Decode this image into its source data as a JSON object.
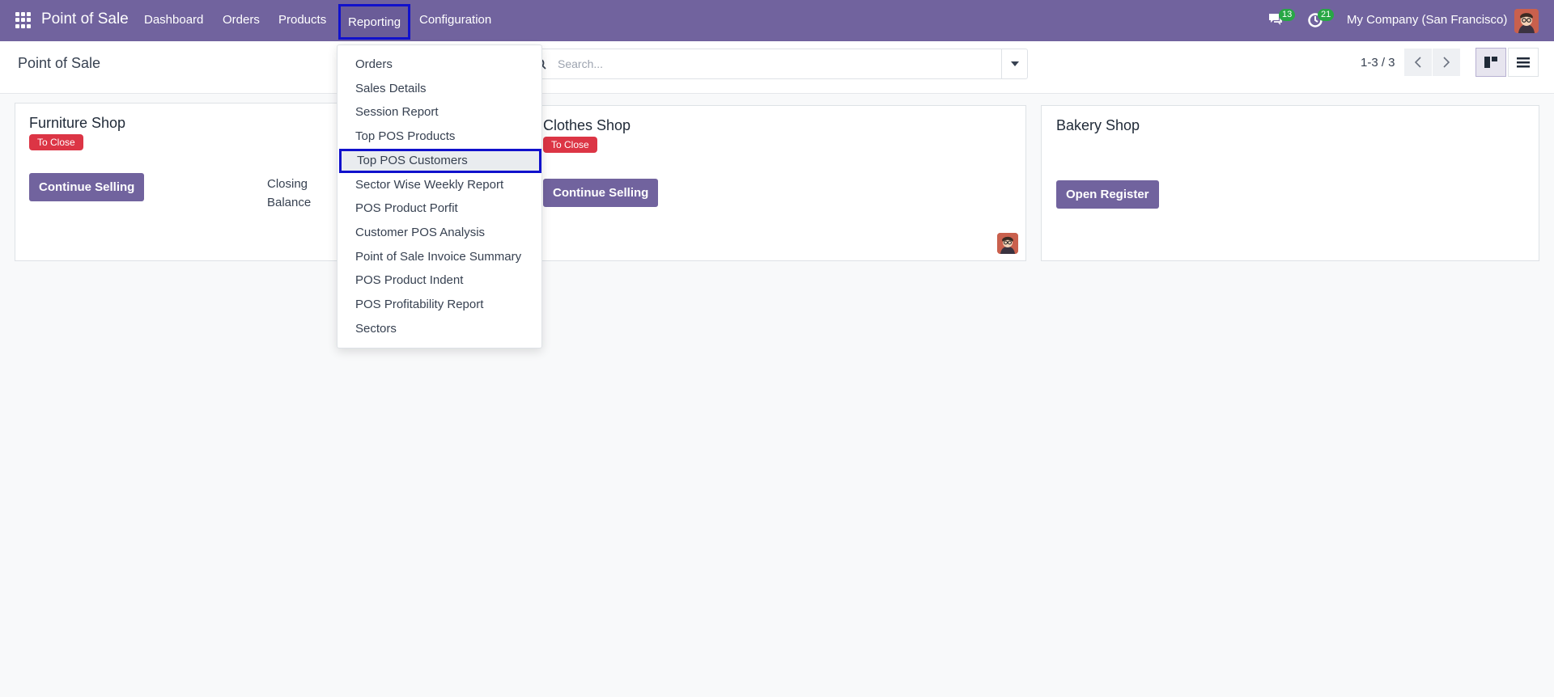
{
  "navbar": {
    "brand": "Point of Sale",
    "menu": [
      {
        "label": "Dashboard"
      },
      {
        "label": "Orders"
      },
      {
        "label": "Products"
      },
      {
        "label": "Reporting"
      },
      {
        "label": "Configuration"
      }
    ],
    "messages_count": "13",
    "activities_count": "21",
    "company": "My Company (San Francisco)"
  },
  "control": {
    "breadcrumb": "Point of Sale",
    "search_placeholder": "Search...",
    "pager": "1-3 / 3"
  },
  "reporting_menu": {
    "items": [
      {
        "label": "Orders"
      },
      {
        "label": "Sales Details"
      },
      {
        "label": "Session Report"
      },
      {
        "label": "Top POS Products"
      },
      {
        "label": "Top POS Customers"
      },
      {
        "label": "Sector Wise Weekly Report"
      },
      {
        "label": "POS Product Porfit"
      },
      {
        "label": "Customer POS Analysis"
      },
      {
        "label": "Point of Sale Invoice Summary"
      },
      {
        "label": "POS Product Indent"
      },
      {
        "label": "POS Profitability Report"
      },
      {
        "label": "Sectors"
      }
    ],
    "highlighted_index": 4
  },
  "shops": [
    {
      "name": "Furniture Shop",
      "status": "To Close",
      "action": "Continue Selling",
      "closing_label": "Closing Balance"
    },
    {
      "name": "Clothes Shop",
      "status": "To Close",
      "action": "Continue Selling"
    },
    {
      "name": "Bakery Shop",
      "action": "Open Register"
    }
  ],
  "colors": {
    "brand": "#71639e",
    "danger": "#dc3545",
    "highlight_border": "#1111cc",
    "badge": "#28a745"
  }
}
